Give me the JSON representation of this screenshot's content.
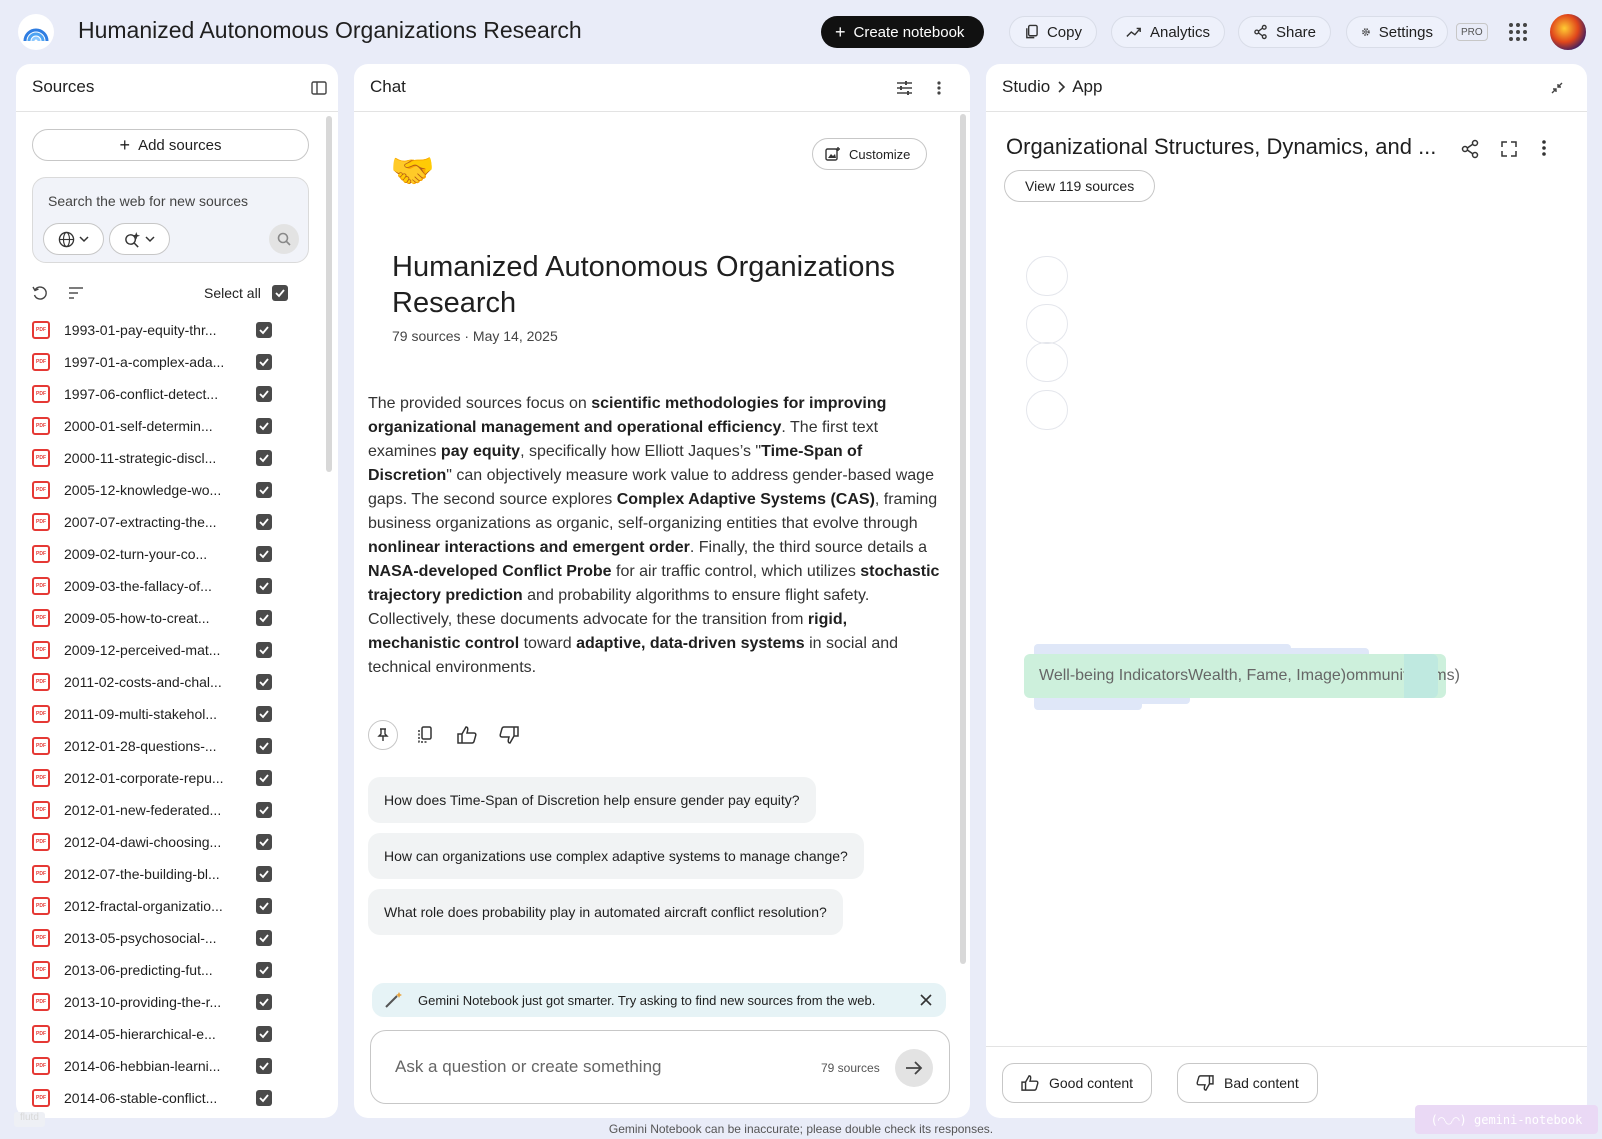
{
  "header": {
    "title": "Humanized Autonomous Organizations Research",
    "create_label": "Create notebook",
    "copy_label": "Copy",
    "analytics_label": "Analytics",
    "share_label": "Share",
    "settings_label": "Settings",
    "pro_label": "PRO"
  },
  "sources": {
    "title": "Sources",
    "add_label": "Add sources",
    "search_placeholder": "Search the web for new sources",
    "select_all_label": "Select all",
    "items": [
      "1993-01-pay-equity-thr...",
      "1997-01-a-complex-ada...",
      "1997-06-conflict-detect...",
      "2000-01-self-determin...",
      "2000-11-strategic-discl...",
      "2005-12-knowledge-wo...",
      "2007-07-extracting-the...",
      "2009-02-turn-your-co...",
      "2009-03-the-fallacy-of...",
      "2009-05-how-to-creat...",
      "2009-12-perceived-mat...",
      "2011-02-costs-and-chal...",
      "2011-09-multi-stakehol...",
      "2012-01-28-questions-...",
      "2012-01-corporate-repu...",
      "2012-01-new-federated...",
      "2012-04-dawi-choosing...",
      "2012-07-the-building-bl...",
      "2012-fractal-organizatio...",
      "2013-05-psychosocial-...",
      "2013-06-predicting-fut...",
      "2013-10-providing-the-r...",
      "2014-05-hierarchical-e...",
      "2014-06-hebbian-learni...",
      "2014-06-stable-conflict..."
    ]
  },
  "chat": {
    "title": "Chat",
    "customize_label": "Customize",
    "emoji": "🤝",
    "notebook_title": "Humanized Autonomous Organizations Research",
    "meta": "79 sources · May 14, 2025",
    "summary": [
      {
        "t": "The provided sources focus on ",
        "b": false
      },
      {
        "t": "scientific methodologies for improving organizational management and operational efficiency",
        "b": true
      },
      {
        "t": ". The first text examines ",
        "b": false
      },
      {
        "t": "pay equity",
        "b": true
      },
      {
        "t": ", specifically how Elliott Jaques’s \"",
        "b": false
      },
      {
        "t": "Time-Span of Discretion",
        "b": true
      },
      {
        "t": "\" can objectively measure work value to address gender-based wage gaps. The second source explores ",
        "b": false
      },
      {
        "t": "Complex Adaptive Systems (CAS)",
        "b": true
      },
      {
        "t": ", framing business organizations as organic, self-organizing entities that evolve through ",
        "b": false
      },
      {
        "t": "nonlinear interactions and emergent order",
        "b": true
      },
      {
        "t": ". Finally, the third source details a ",
        "b": false
      },
      {
        "t": "NASA-developed Conflict Probe",
        "b": true
      },
      {
        "t": " for air traffic control, which utilizes ",
        "b": false
      },
      {
        "t": "stochastic trajectory prediction",
        "b": true
      },
      {
        "t": " and probability algorithms to ensure flight safety. Collectively, these documents advocate for the transition from ",
        "b": false
      },
      {
        "t": "rigid, mechanistic control",
        "b": true
      },
      {
        "t": " toward ",
        "b": false
      },
      {
        "t": "adaptive, data-driven systems",
        "b": true
      },
      {
        "t": " in social and technical environments.",
        "b": false
      }
    ],
    "suggestions": [
      "How does Time-Span of Discretion help ensure gender pay equity?",
      "How can organizations use complex adaptive systems to manage change?",
      "What role does probability play in automated aircraft conflict resolution?"
    ],
    "notice": "Gemini Notebook just got smarter. Try asking to find new sources from the web.",
    "ask_placeholder": "Ask a question or create something",
    "ask_count": "79 sources"
  },
  "studio": {
    "crumb_1": "Studio",
    "crumb_2": "App",
    "title": "Organizational Structures, Dynamics, and ...",
    "view_sources_label": "View 119 sources",
    "mindmap_text": "Well-being IndicatorsWealth, Fame, Image)ommunityItems)",
    "good_label": "Good content",
    "bad_label": "Bad content"
  },
  "footer": {
    "note": "Gemini Notebook can be inaccurate; please double check its responses.",
    "watermark_left": "flutd",
    "watermark_right": "(◠◡◠) gemini-notebook"
  }
}
